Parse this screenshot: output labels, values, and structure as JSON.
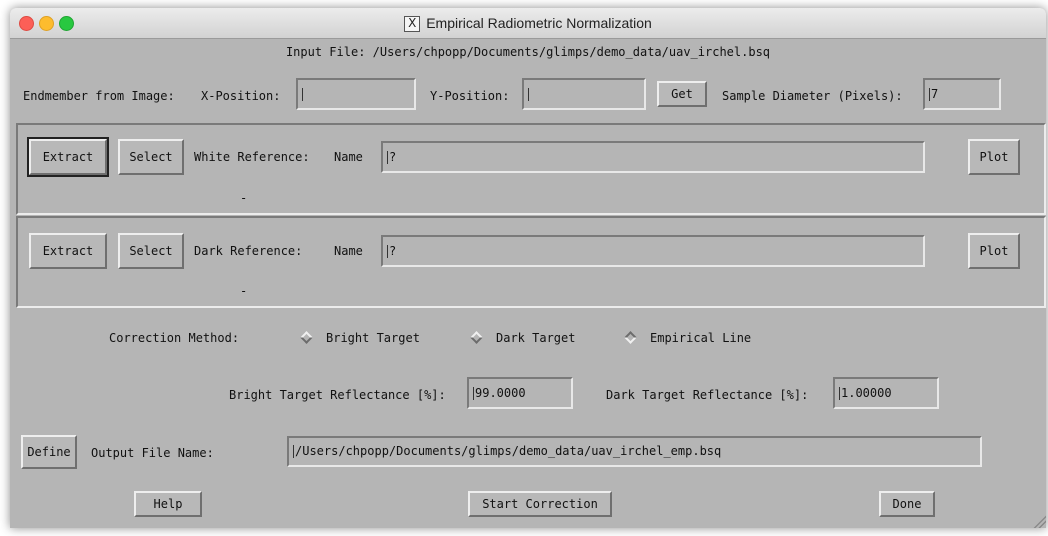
{
  "window": {
    "title": "Empirical Radiometric Normalization",
    "title_icon": "X"
  },
  "input_file": {
    "label": "Input File:",
    "path": "/Users/chpopp/Documents/glimps/demo_data/uav_irchel.bsq"
  },
  "endmember": {
    "label": "Endmember from Image:",
    "x_label": "X-Position:",
    "x_value": "",
    "y_label": "Y-Position:",
    "y_value": "",
    "get_label": "Get",
    "diam_label": "Sample Diameter (Pixels):",
    "diam_value": "7"
  },
  "white_ref": {
    "extract_label": "Extract",
    "select_label": "Select",
    "ref_label": "White Reference:",
    "name_label": "Name",
    "name_value": "?",
    "plot_label": "Plot",
    "status": "-"
  },
  "dark_ref": {
    "extract_label": "Extract",
    "select_label": "Select",
    "ref_label": "Dark Reference:",
    "name_label": "Name",
    "name_value": "?",
    "plot_label": "Plot",
    "status": "-"
  },
  "correction": {
    "label": "Correction Method:",
    "options": [
      {
        "label": "Bright Target",
        "selected": false
      },
      {
        "label": "Dark Target",
        "selected": false
      },
      {
        "label": "Empirical Line",
        "selected": true
      }
    ]
  },
  "reflectance": {
    "bright_label": "Bright Target Reflectance [%]:",
    "bright_value": "99.0000",
    "dark_label": "Dark Target Reflectance [%]:",
    "dark_value": "1.00000"
  },
  "output": {
    "define_label": "Define",
    "label": "Output File Name:",
    "path": "/Users/chpopp/Documents/glimps/demo_data/uav_irchel_emp.bsq"
  },
  "footer": {
    "help_label": "Help",
    "start_label": "Start Correction",
    "done_label": "Done"
  }
}
